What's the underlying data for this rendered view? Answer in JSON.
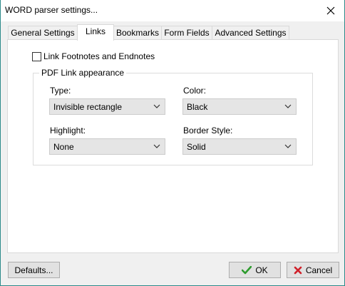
{
  "window": {
    "title": "WORD parser settings..."
  },
  "tabs": [
    {
      "label": "General Settings"
    },
    {
      "label": "Links"
    },
    {
      "label": "Bookmarks"
    },
    {
      "label": "Form Fields"
    },
    {
      "label": "Advanced Settings"
    }
  ],
  "active_tab": "Links",
  "links": {
    "checkbox_label": "Link Footnotes and Endnotes",
    "checkbox_checked": false,
    "group_title": "PDF Link appearance",
    "type_label": "Type:",
    "type_value": "Invisible rectangle",
    "color_label": "Color:",
    "color_value": "Black",
    "highlight_label": "Highlight:",
    "highlight_value": "None",
    "border_label": "Border Style:",
    "border_value": "Solid"
  },
  "buttons": {
    "defaults": "Defaults...",
    "ok": "OK",
    "cancel": "Cancel"
  },
  "colors": {
    "ok_check": "#2e9c2e",
    "cancel_x": "#d0202a",
    "window_border": "#2c8a8a"
  }
}
